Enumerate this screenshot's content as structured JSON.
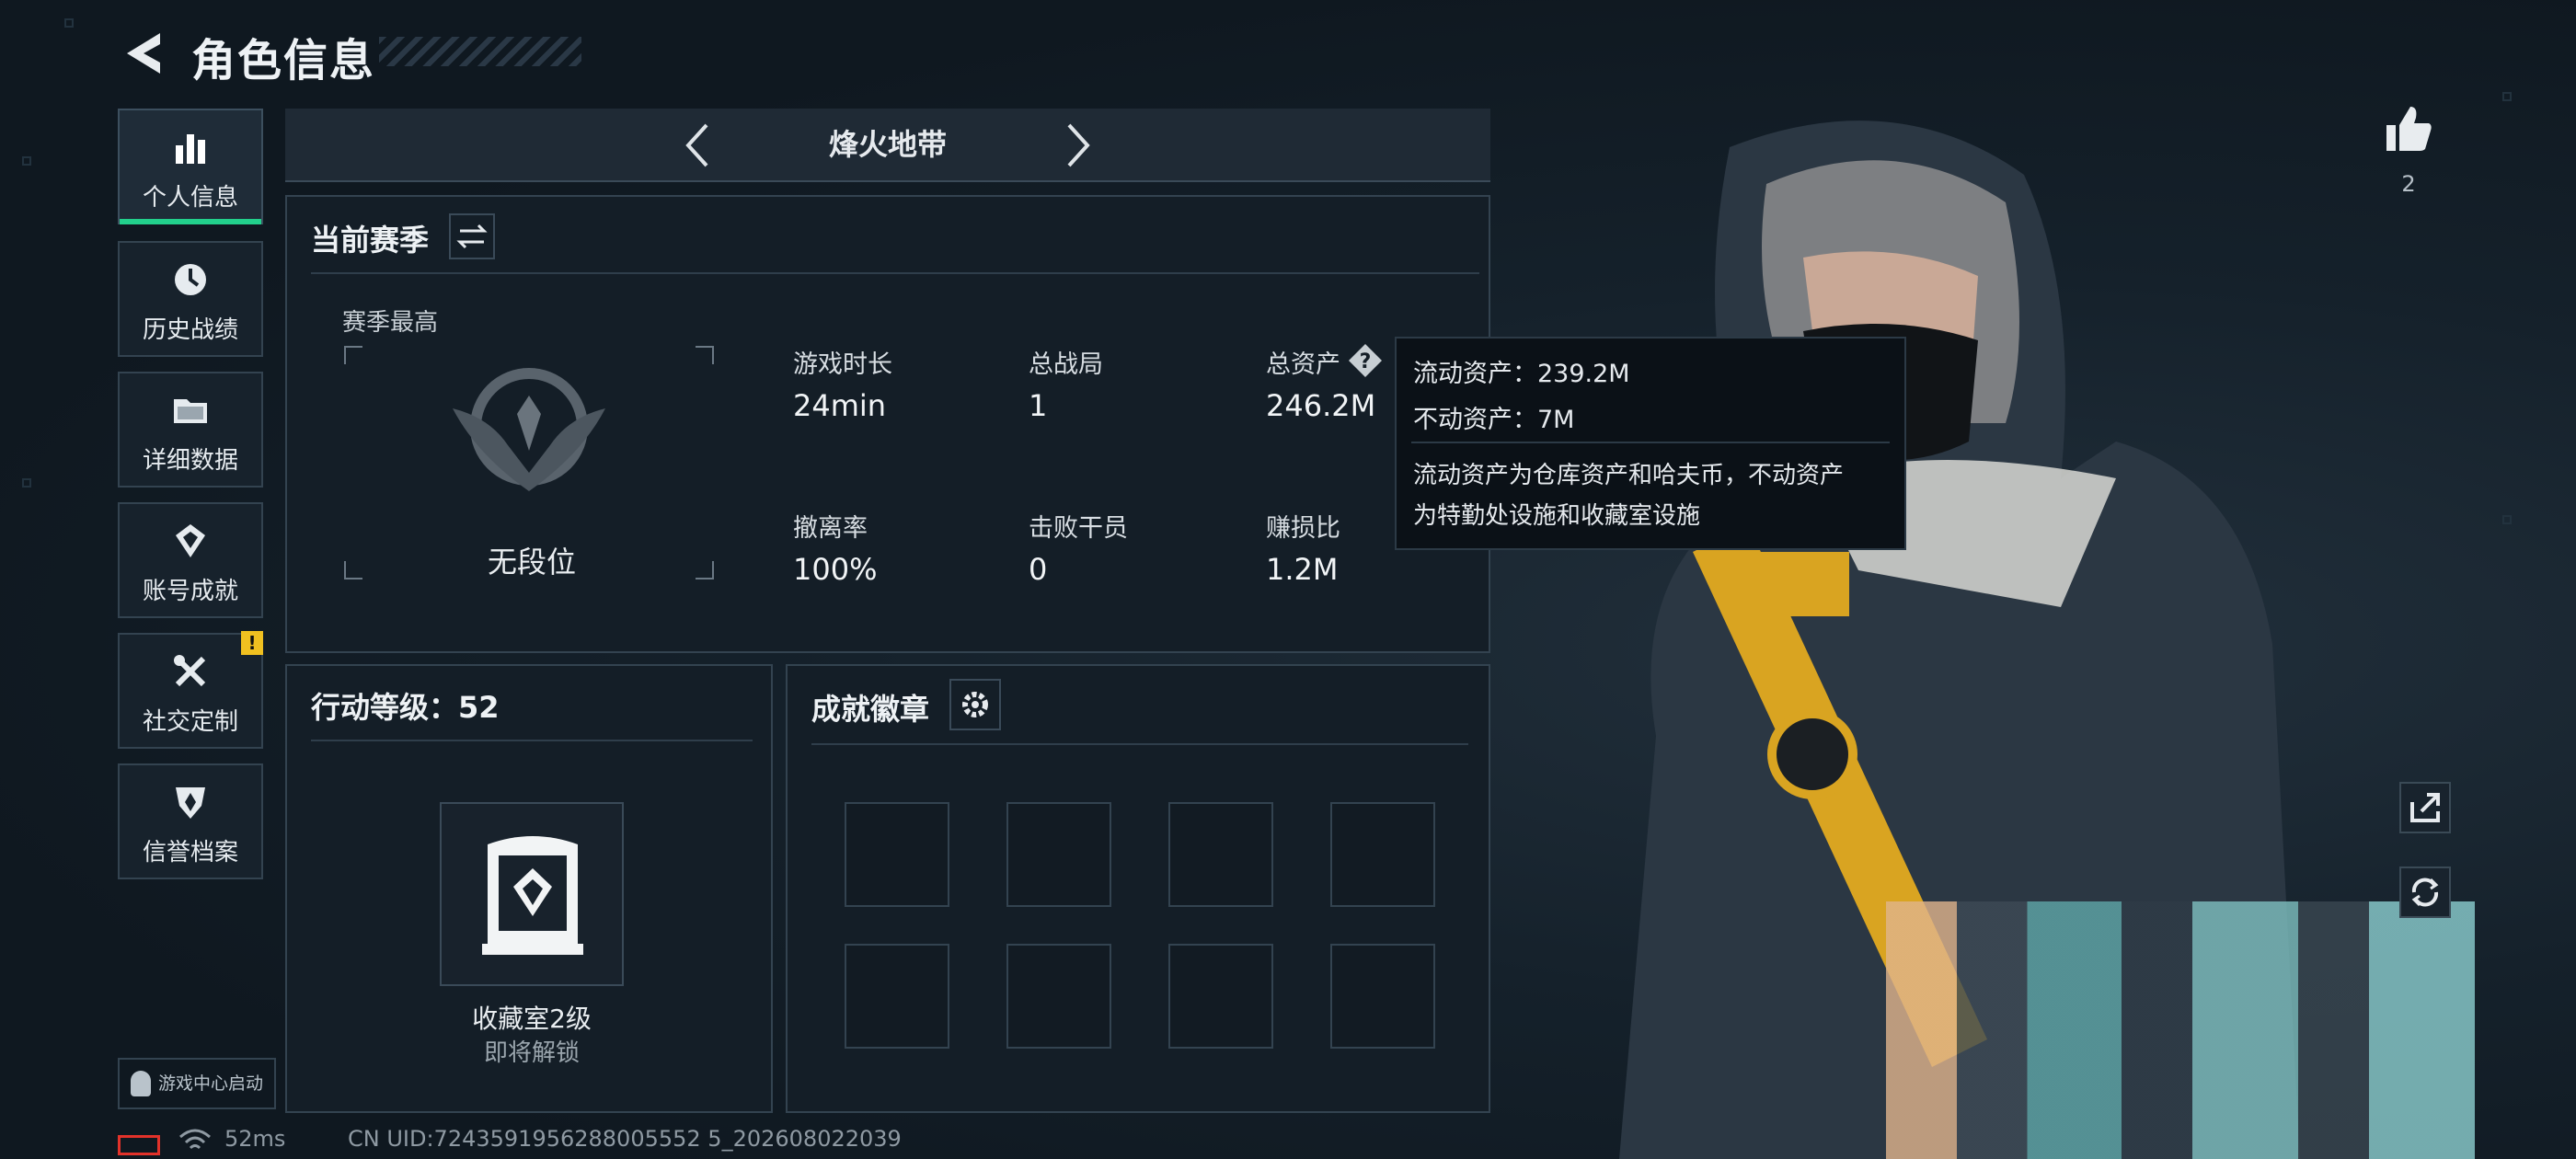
{
  "header": {
    "title": "角色信息"
  },
  "sidebar": {
    "items": [
      {
        "label": "个人信息",
        "icon": "bar-chart-icon"
      },
      {
        "label": "历史战绩",
        "icon": "clock-icon"
      },
      {
        "label": "详细数据",
        "icon": "folder-icon"
      },
      {
        "label": "账号成就",
        "icon": "achievement-icon"
      },
      {
        "label": "社交定制",
        "icon": "tools-icon",
        "badge": "!"
      },
      {
        "label": "信誉档案",
        "icon": "shield-icon"
      }
    ],
    "launch_label": "游戏中心启动"
  },
  "mode": {
    "title": "烽火地带"
  },
  "season": {
    "title": "当前赛季",
    "best_label": "赛季最高",
    "rank": "无段位",
    "stats": [
      {
        "label": "游戏时长",
        "value": "24min"
      },
      {
        "label": "总战局",
        "value": "1"
      },
      {
        "label": "总资产",
        "value": "246.2M"
      },
      {
        "label": "撤离率",
        "value": "100%"
      },
      {
        "label": "击败干员",
        "value": "0"
      },
      {
        "label": "赚损比",
        "value": "1.2M"
      }
    ]
  },
  "tooltip": {
    "liquid": "流动资产：239.2M",
    "fixed": "不动资产：7M",
    "desc1": "流动资产为仓库资产和哈夫币，不动资产",
    "desc2": "为特勤处设施和收藏室设施"
  },
  "action_level": {
    "title": "行动等级：52",
    "room_name": "收藏室2级",
    "room_status": "即将解锁"
  },
  "badges": {
    "title": "成就徽章"
  },
  "right": {
    "likes": "2"
  },
  "status": {
    "ping": "52ms",
    "uid": "CN UID:7243591956288005552 5_202608022039"
  },
  "colors": {
    "accent": "#22d08c",
    "warning": "#f0c020",
    "panel_border": "#334350"
  }
}
